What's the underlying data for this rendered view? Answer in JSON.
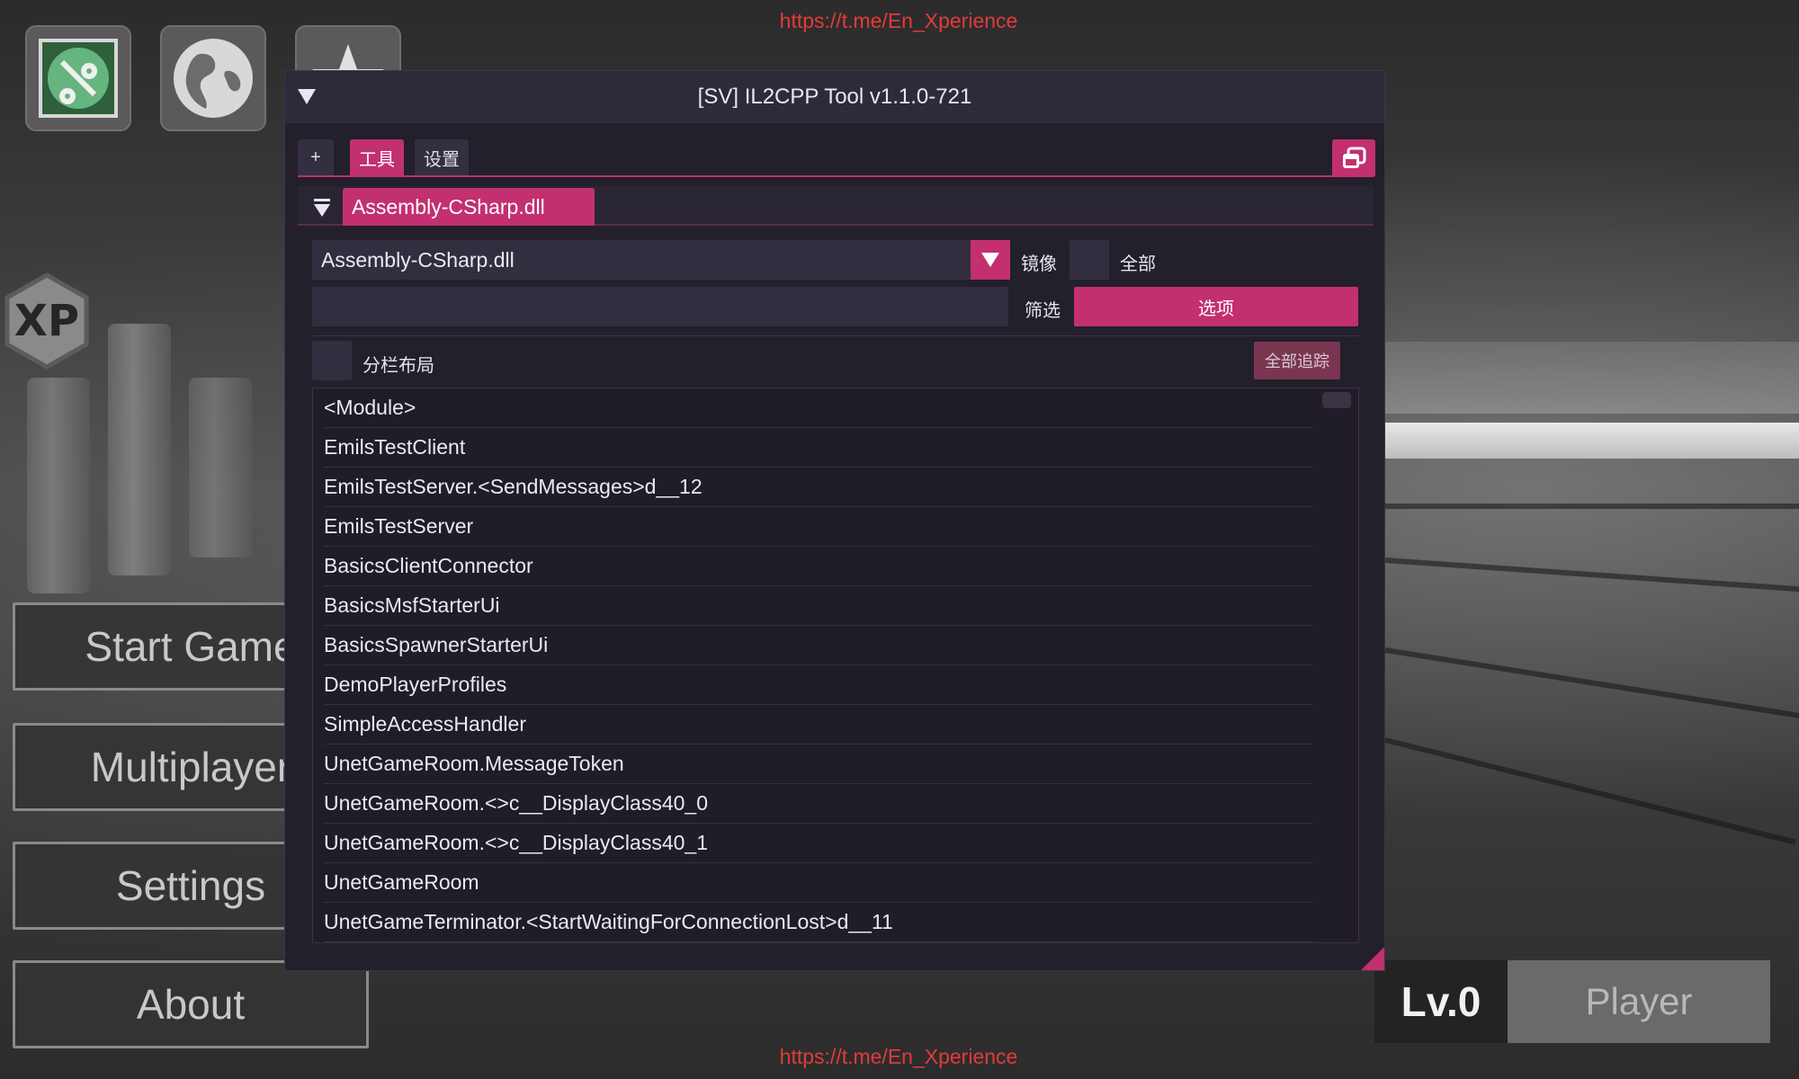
{
  "watermark": {
    "top": "https://t.me/En_Xperience",
    "bottom": "https://t.me/En_Xperience"
  },
  "hud": {
    "icons": [
      "settings-tools-icon",
      "globe-icon",
      "star-icon"
    ],
    "xp_badge": "XP",
    "menu": {
      "start": "Start Game",
      "multiplayer": "Multiplayer",
      "settings": "Settings",
      "about": "About"
    },
    "level": "Lv.0",
    "player": "Player"
  },
  "tool": {
    "title": "[SV] IL2CPP Tool v1.1.0-721",
    "tabs": {
      "add": "+",
      "tools": "工具",
      "settings": "设置"
    },
    "section_title": "Assembly-CSharp.dll",
    "assembly_select": "Assembly-CSharp.dll",
    "mirror_label": "镜像",
    "all_label": "全部",
    "filter_label": "筛选",
    "filter_value": "",
    "options_label": "选项",
    "split_layout_label": "分栏布局",
    "trace_all_label": "全部追踪",
    "classes": [
      "<Module>",
      "EmilsTestClient",
      "EmilsTestServer.<SendMessages>d__12",
      "EmilsTestServer",
      "BasicsClientConnector",
      "BasicsMsfStarterUi",
      "BasicsSpawnerStarterUi",
      "DemoPlayerProfiles",
      "SimpleAccessHandler",
      "UnetGameRoom.MessageToken",
      "UnetGameRoom.<>c__DisplayClass40_0",
      "UnetGameRoom.<>c__DisplayClass40_1",
      "UnetGameRoom",
      "UnetGameTerminator.<StartWaitingForConnectionLost>d__11"
    ]
  },
  "colors": {
    "accent": "#c2306f",
    "window_bg": "#231f2b",
    "titlebar": "#2f2a3a",
    "watermark": "#e23b3b"
  }
}
